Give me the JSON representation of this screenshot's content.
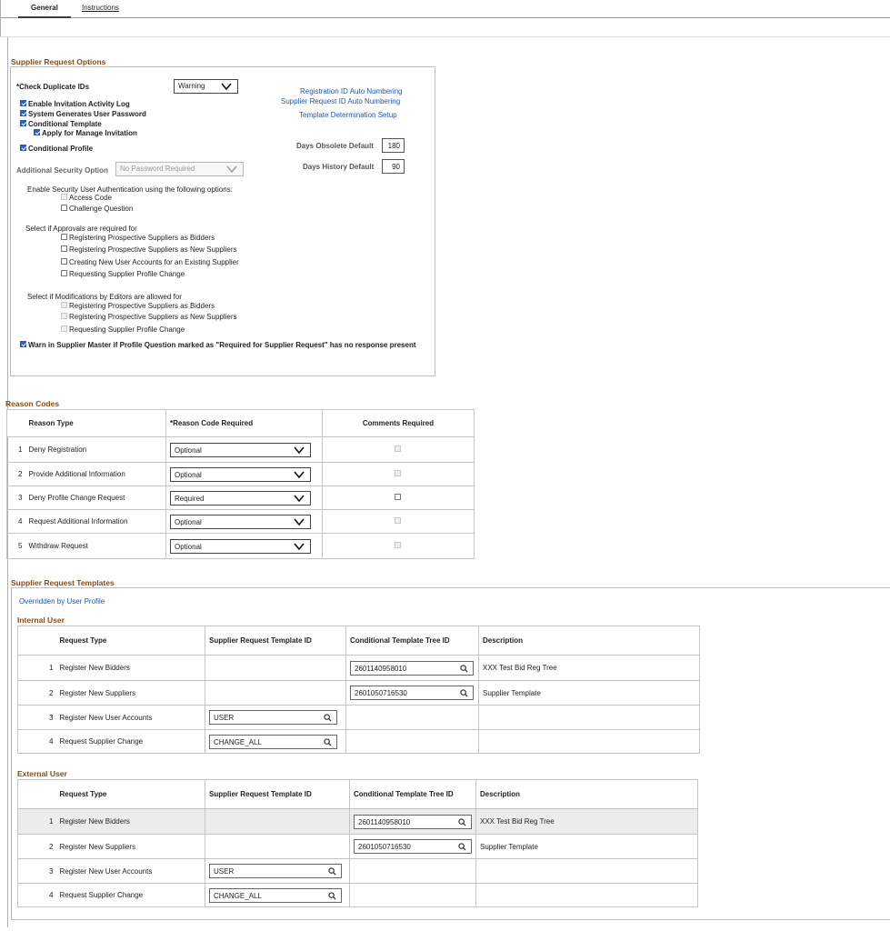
{
  "tabs": [
    {
      "label": "General",
      "active": true
    },
    {
      "label": "Instructions",
      "active": false
    }
  ],
  "supplier_request_options": {
    "title": "Supplier Request Options",
    "check_duplicate_ids_label": "*Check Duplicate IDs",
    "check_duplicate_ids_value": "Warning",
    "enable_invitation_activity_log": "Enable Invitation Activity Log",
    "system_generates_user_password": "System Generates User Password",
    "conditional_template": "Conditional Template",
    "apply_for_manage_invitation": "Apply for Manage Invitation",
    "conditional_profile": "Conditional Profile",
    "additional_security_option_label": "Additional Security Option",
    "additional_security_option_value": "No Password Required",
    "links": {
      "registration_id": "Registration ID Auto Numbering",
      "supplier_request_id": "Supplier Request ID Auto Numbering",
      "template_determination": "Template Determination Setup"
    },
    "days_obsolete_label": "Days Obsolete Default",
    "days_obsolete_value": "180",
    "days_history_label": "Days History Default",
    "days_history_value": "90",
    "security_auth_label": "Enable Security User Authentication using the following options:",
    "access_code": "Access Code",
    "challenge_question": "Challenge Question",
    "approvals_label": "Select if Approvals are required for",
    "approvals": [
      "Registering Prospective Suppliers as Bidders",
      "Registering Prospective Suppliers as New Suppliers",
      "Creating New User Accounts for an Existing Supplier",
      "Requesting Supplier Profile Change"
    ],
    "modifications_label": "Select if Modifications by Editors are allowed for",
    "modifications": [
      "Registering Prospective Suppliers as Bidders",
      "Registering Prospective Suppliers as New Suppliers",
      "Requesting Supplier Profile Change"
    ],
    "warn_label": "Warn in Supplier Master if Profile Question marked as \"Required for Supplier Request\" has no response present"
  },
  "reason_codes": {
    "title": "Reason Codes",
    "headers": {
      "reason_type": "Reason Type",
      "reason_code_required": "*Reason Code Required",
      "comments_required": "Comments Required"
    },
    "rows": [
      {
        "n": "1",
        "type": "Deny Registration",
        "required": "Optional"
      },
      {
        "n": "2",
        "type": "Provide Additional Information",
        "required": "Optional"
      },
      {
        "n": "3",
        "type": "Deny Profile Change Request",
        "required": "Required"
      },
      {
        "n": "4",
        "type": "Request Additional Information",
        "required": "Optional"
      },
      {
        "n": "5",
        "type": "Withdraw Request",
        "required": "Optional"
      }
    ]
  },
  "templates": {
    "title": "Supplier Request Templates",
    "overridden_link": "Overridden by User Profile",
    "headers": {
      "request_type": "Request Type",
      "template_id": "Supplier Request Template ID",
      "tree_id": "Conditional Template Tree ID",
      "description": "Description"
    },
    "internal": {
      "title": "Internal User",
      "rows": [
        {
          "n": "1",
          "type": "Register New Bidders",
          "template": "",
          "tree": "2601140958010",
          "desc": "XXX Test Bid Reg Tree"
        },
        {
          "n": "2",
          "type": "Register New Suppliers",
          "template": "",
          "tree": "2601050716530",
          "desc": "Supplier Template"
        },
        {
          "n": "3",
          "type": "Register New User Accounts",
          "template": "USER",
          "tree": "",
          "desc": ""
        },
        {
          "n": "4",
          "type": "Request Supplier Change",
          "template": "CHANGE_ALL",
          "tree": "",
          "desc": ""
        }
      ]
    },
    "external": {
      "title": "External User",
      "rows": [
        {
          "n": "1",
          "type": "Register New Bidders",
          "template": "",
          "tree": "2601140958010",
          "desc": "XXX Test Bid Reg Tree"
        },
        {
          "n": "2",
          "type": "Register New Suppliers",
          "template": "",
          "tree": "2601050716530",
          "desc": "Supplier Template"
        },
        {
          "n": "3",
          "type": "Register New User Accounts",
          "template": "USER",
          "tree": "",
          "desc": ""
        },
        {
          "n": "4",
          "type": "Request Supplier Change",
          "template": "CHANGE_ALL",
          "tree": "",
          "desc": ""
        }
      ]
    }
  }
}
